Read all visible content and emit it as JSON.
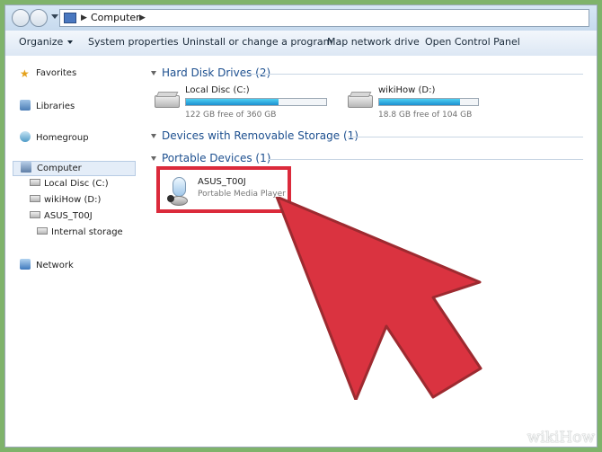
{
  "window": {
    "address": {
      "path": "Computer"
    }
  },
  "toolbar": {
    "organize": "Organize",
    "system_properties": "System properties",
    "uninstall": "Uninstall or change a program",
    "map_network_drive": "Map network drive",
    "open_control_panel": "Open Control Panel"
  },
  "sidebar": {
    "favorites": "Favorites",
    "libraries": "Libraries",
    "homegroup": "Homegroup",
    "computer": "Computer",
    "local_disc": "Local Disc (C:)",
    "wikihow_drive": "wikiHow (D:)",
    "asus": "ASUS_T00J",
    "internal_storage": "Internal storage",
    "network": "Network"
  },
  "content": {
    "hard_disk_header": "Hard Disk Drives (2)",
    "removable_header": "Devices with Removable Storage (1)",
    "portable_header": "Portable Devices (1)",
    "drives": [
      {
        "name": "Local Disc (C:)",
        "free": "122 GB free of 360 GB",
        "used_fraction": 0.661
      },
      {
        "name": "wikiHow (D:)",
        "free": "18.8 GB free of 104 GB",
        "used_fraction": 0.819
      }
    ],
    "portable_device": {
      "name": "ASUS_T00J",
      "type": "Portable Media Player"
    }
  },
  "watermark": "wikiHow",
  "colors": {
    "frame_green": "#7fb36b",
    "highlight_red": "#db2a3b",
    "bar_blue": "#1c8fd0",
    "header_blue": "#1c4f8f"
  },
  "icons": {
    "favorites": "star-icon",
    "libraries": "library-icon",
    "homegroup": "homegroup-icon",
    "computer": "computer-icon",
    "network": "network-icon",
    "drive": "hard-disk-icon",
    "device": "media-player-icon"
  }
}
